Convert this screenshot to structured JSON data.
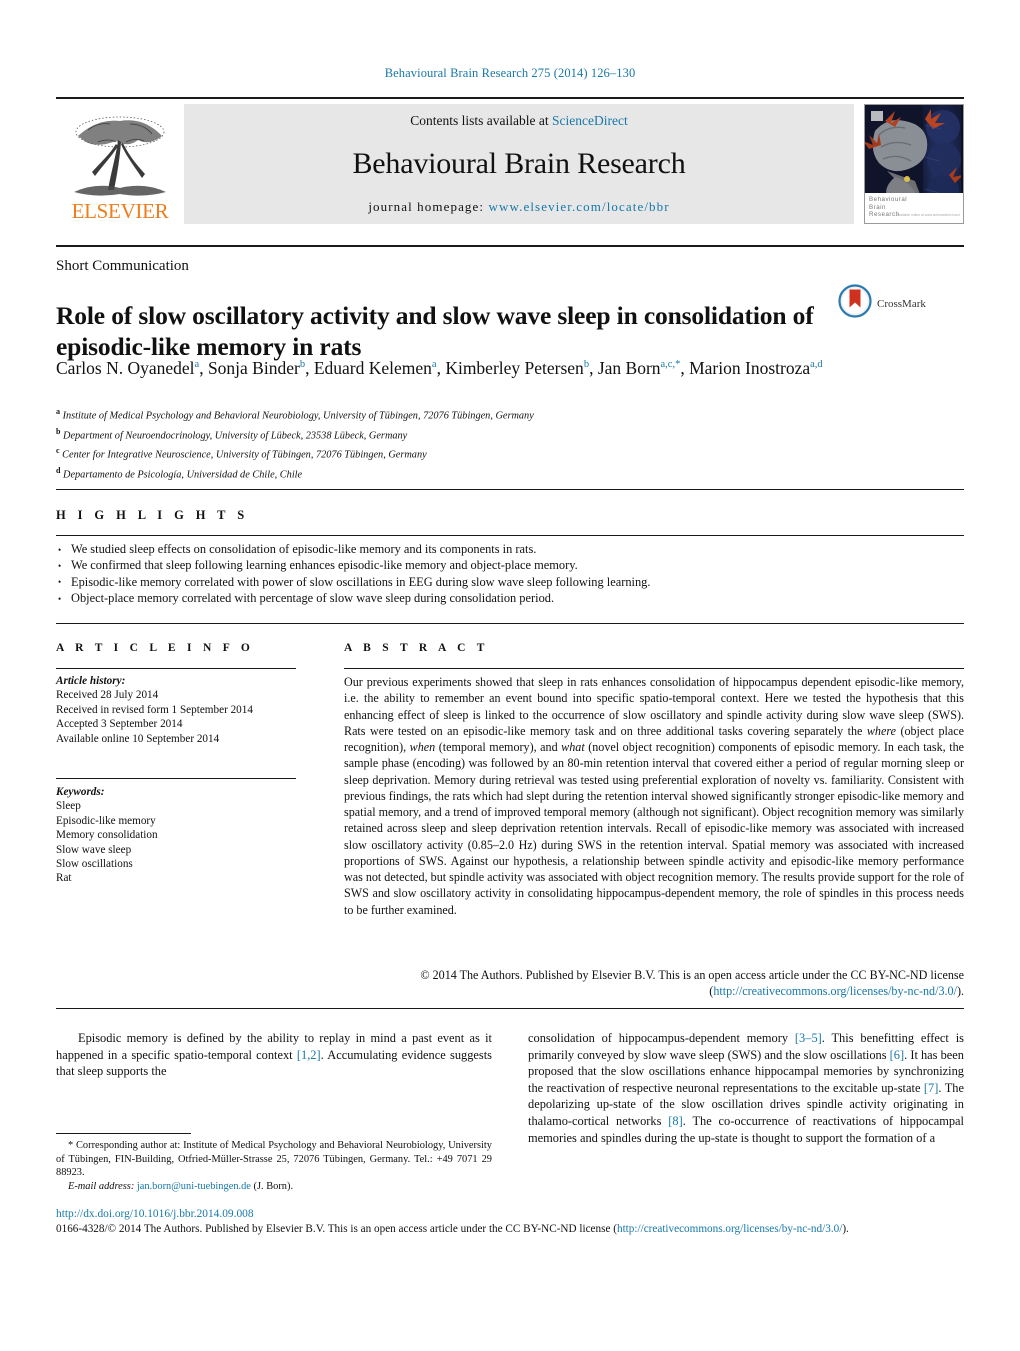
{
  "running_head": "Behavioural Brain Research 275 (2014) 126–130",
  "banner": {
    "publisher": "ELSEVIER",
    "contents_prefix": "Contents lists available at ",
    "contents_link": "ScienceDirect",
    "journal_name": "Behavioural Brain Research",
    "homepage_prefix": "journal homepage: ",
    "homepage_url": "www.elsevier.com/locate/bbr",
    "cover_caption_line1": "Behavioural",
    "cover_caption_line2": "Brain",
    "cover_caption_line3": "Research",
    "cover_caption_tiny": "available online at www.sciencedirect.com"
  },
  "article": {
    "section_type": "Short Communication",
    "title": "Role of slow oscillatory activity and slow wave sleep in consolidation of episodic-like memory in rats",
    "crossmark_label": "CrossMark",
    "authors": [
      {
        "name": "Carlos N. Oyanedel",
        "marks": "a"
      },
      {
        "name": "Sonja Binder",
        "marks": "b"
      },
      {
        "name": "Eduard Kelemen",
        "marks": "a"
      },
      {
        "name": "Kimberley Petersen",
        "marks": "b"
      },
      {
        "name": "Jan Born",
        "marks": "a,c,*"
      },
      {
        "name": "Marion Inostroza",
        "marks": "a,d"
      }
    ],
    "affiliations": [
      {
        "mark": "a",
        "text": "Institute of Medical Psychology and Behavioral Neurobiology, University of Tübingen, 72076 Tübingen, Germany"
      },
      {
        "mark": "b",
        "text": "Department of Neuroendocrinology, University of Lübeck, 23538 Lübeck, Germany"
      },
      {
        "mark": "c",
        "text": "Center for Integrative Neuroscience, University of Tübingen, 72076 Tübingen, Germany"
      },
      {
        "mark": "d",
        "text": "Departamento de Psicología, Universidad de Chile, Chile"
      }
    ]
  },
  "highlights": {
    "heading": "H I G H L I G H T S",
    "items": [
      "We studied sleep effects on consolidation of episodic-like memory and its components in rats.",
      "We confirmed that sleep following learning enhances episodic-like memory and object-place memory.",
      "Episodic-like memory correlated with power of slow oscillations in EEG during slow wave sleep following learning.",
      "Object-place memory correlated with percentage of slow wave sleep during consolidation period."
    ],
    "bullet_glyph": "•"
  },
  "article_info": {
    "heading": "A R T I C L E   I N F O",
    "history_label": "Article history:",
    "history": [
      "Received 28 July 2014",
      "Received in revised form 1 September 2014",
      "Accepted 3 September 2014",
      "Available online 10 September 2014"
    ],
    "keywords_label": "Keywords:",
    "keywords": [
      "Sleep",
      "Episodic-like memory",
      "Memory consolidation",
      "Slow wave sleep",
      "Slow oscillations",
      "Rat"
    ]
  },
  "abstract": {
    "heading": "A B S T R A C T",
    "p1_a": "Our previous experiments showed that sleep in rats enhances consolidation of hippocampus dependent episodic-like memory, i.e. the ability to remember an event bound into specific spatio-temporal context. Here we tested the hypothesis that this enhancing effect of sleep is linked to the occurrence of slow oscillatory and spindle activity during slow wave sleep (SWS). Rats were tested on an episodic-like memory task and on three additional tasks covering separately the ",
    "it_where": "where",
    "p1_b": " (object place recognition), ",
    "it_when": "when",
    "p1_c": " (temporal memory), and ",
    "it_what": "what",
    "p1_d": " (novel object recognition) components of episodic memory. In each task, the sample phase (encoding) was followed by an 80-min retention interval that covered either a period of regular morning sleep or sleep deprivation. Memory during retrieval was tested using preferential exploration of novelty vs. familiarity. Consistent with previous findings, the rats which had slept during the retention interval showed significantly stronger episodic-like memory and spatial memory, and a trend of improved temporal memory (although not significant). Object recognition memory was similarly retained across sleep and sleep deprivation retention intervals. Recall of episodic-like memory was associated with increased slow oscillatory activity (0.85–2.0 Hz) during SWS in the retention interval. Spatial memory was associated with increased proportions of SWS. Against our hypothesis, a relationship between spindle activity and episodic-like memory performance was not detected, but spindle activity was associated with object recognition memory. The results provide support for the role of SWS and slow oscillatory activity in consolidating hippocampus-dependent memory, the role of spindles in this process needs to be further examined.",
    "copyright_a": "© 2014 The Authors. Published by Elsevier B.V. This is an open access article under the CC BY-NC-ND license (",
    "copyright_link": "http://creativecommons.org/licenses/by-nc-nd/3.0/",
    "copyright_b": ")."
  },
  "body": {
    "left_p1_a": "Episodic memory is defined by the ability to replay in mind a past event as it happened in a specific spatio-temporal context ",
    "left_ref_1": "[1,2]",
    "left_p1_b": ". Accumulating evidence suggests that sleep supports the",
    "right_p1_a": "consolidation of hippocampus-dependent memory ",
    "right_ref_1": "[3–5]",
    "right_p1_b": ". This benefitting effect is primarily conveyed by slow wave sleep (SWS) and the slow oscillations ",
    "right_ref_2": "[6]",
    "right_p1_c": ". It has been proposed that the slow oscillations enhance hippocampal memories by synchronizing the reactivation of respective neuronal representations to the excitable up-state ",
    "right_ref_3": "[7]",
    "right_p1_d": ". The depolarizing up-state of the slow oscillation drives spindle activity originating in thalamo-cortical networks ",
    "right_ref_4": "[8]",
    "right_p1_e": ". The co-occurrence of reactivations of hippocampal memories and spindles during the up-state is thought to support the formation of a"
  },
  "footnote": {
    "star": "*",
    "corresponding": " Corresponding author at: Institute of Medical Psychology and Behavioral Neurobiology, University of Tübingen, FIN-Building, Otfried-Müller-Strasse 25, 72076 Tübingen, Germany. Tel.: +49 7071 29 88923.",
    "email_label": "E-mail address:",
    "email": "jan.born@uni-tuebingen.de",
    "email_suffix": " (J. Born)."
  },
  "footer": {
    "doi": "http://dx.doi.org/10.1016/j.bbr.2014.09.008",
    "issn_a": "0166-4328/© 2014 The Authors. Published by Elsevier B.V. This is an open access article under the CC BY-NC-ND license (",
    "issn_link": "http://creativecommons.org/licenses/by-nc-nd/3.0/",
    "issn_b": ")."
  },
  "colors": {
    "link": "#1878a8",
    "elsevier_orange": "#ef7d1a",
    "banner_grey": "#e7e7e7"
  }
}
